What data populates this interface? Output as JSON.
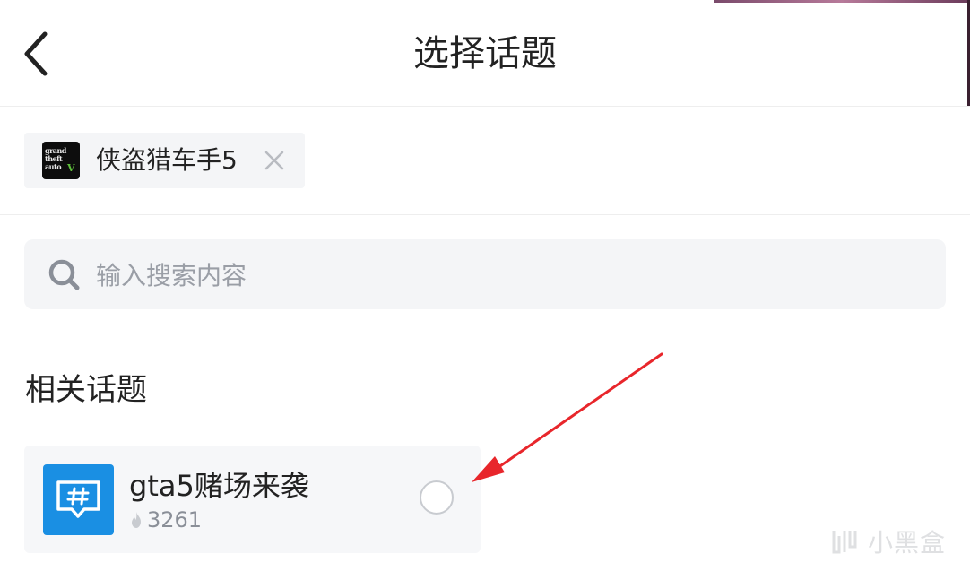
{
  "header": {
    "title": "选择话题"
  },
  "selected_game": {
    "name": "侠盗猎车手5",
    "logo_text": [
      "grand",
      "theft",
      "auto"
    ],
    "logo_mark": "V"
  },
  "search": {
    "placeholder": "输入搜索内容"
  },
  "related": {
    "section_title": "相关话题",
    "topics": [
      {
        "title": "gta5赌场来袭",
        "heat": "3261",
        "selected": false
      }
    ]
  },
  "watermark": {
    "text": "小黑盒"
  },
  "colors": {
    "topic_icon_bg": "#1a8fe3",
    "arrow": "#e8262b",
    "chip_bg": "#f4f5f7"
  },
  "icons": [
    "chevron-left-icon",
    "close-icon",
    "search-icon",
    "hashtag-chat-icon",
    "flame-icon",
    "radio-icon"
  ]
}
